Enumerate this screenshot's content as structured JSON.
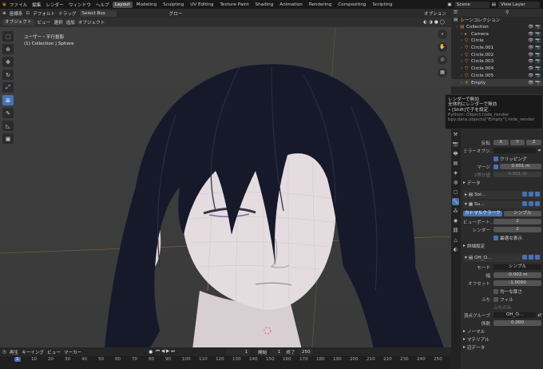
{
  "topbar": {
    "menus": [
      "ファイル",
      "編集",
      "レンダー",
      "ウィンドウ",
      "ヘルプ"
    ],
    "workspaces": [
      "Layout",
      "Modeling",
      "Sculpting",
      "UV Editing",
      "Texture Paint",
      "Shading",
      "Animation",
      "Rendering",
      "Compositing",
      "Scripting"
    ],
    "scene": "Scene",
    "view_layer": "View Layer"
  },
  "viewport": {
    "header1": {
      "mode_items": [
        "座標系",
        "デフォルト",
        "ドラッグ"
      ],
      "select_box": "Select Box",
      "global": "グロー",
      "options": "オプション"
    },
    "header2": {
      "object_mode": "オブジェクト",
      "menus": [
        "ビュー",
        "選択",
        "追加",
        "オブジェクト"
      ]
    },
    "overlay_title": "ユーザー・平行投影",
    "overlay_sub": "(1) Collection | Sphere"
  },
  "timeline": {
    "menus": [
      "再生",
      "キーイング",
      "ビュー",
      "マーカー"
    ],
    "frame": "1",
    "start_label": "開始",
    "start": "1",
    "end_label": "終了",
    "end": "250",
    "ruler": [
      "1",
      "10",
      "20",
      "30",
      "40",
      "50",
      "60",
      "70",
      "80",
      "90",
      "100",
      "110",
      "120",
      "130",
      "140",
      "150",
      "160",
      "170",
      "180",
      "190",
      "200",
      "210",
      "220",
      "230",
      "240",
      "250"
    ]
  },
  "outliner": {
    "title": "シーンコレクション",
    "items": [
      {
        "name": "Collection",
        "level": 0,
        "icon": "collection"
      },
      {
        "name": "Camera",
        "level": 1,
        "icon": "camera"
      },
      {
        "name": "Circle",
        "level": 1,
        "icon": "mesh"
      },
      {
        "name": "Circle.001",
        "level": 1,
        "icon": "mesh"
      },
      {
        "name": "Circle.002",
        "level": 1,
        "icon": "mesh"
      },
      {
        "name": "Circle.003",
        "level": 1,
        "icon": "mesh"
      },
      {
        "name": "Circle.004",
        "level": 1,
        "icon": "mesh"
      },
      {
        "name": "Circle.005",
        "level": 1,
        "icon": "mesh"
      },
      {
        "name": "Empty",
        "level": 1,
        "icon": "empty"
      }
    ]
  },
  "tooltip": {
    "line1": "レンダーで無効",
    "line2": "全体的にレンダーで無効",
    "line3": "• [Shift]で子を設定.",
    "py1": "Python: Object.hide_render",
    "py2": "bpy.data.objects[\"Empty\"].hide_render"
  },
  "properties": {
    "mirror": {
      "axis_label": "反転",
      "axes": [
        "X",
        "Y",
        "Z"
      ],
      "mirror_obj_label": "ミラーオブジ…",
      "clipping": "クリッピング",
      "merge_label": "マージ",
      "merge_value": "0.001 m",
      "bisect_label": "2等分値",
      "bisect_value": "0.001 m",
      "data": "データ"
    },
    "mod2": {
      "name": "Sol…"
    },
    "mod3": {
      "name": "Su…",
      "tab_catmull": "カトマルクラーク",
      "tab_simple": "シンプル",
      "viewport_label": "ビューポート…",
      "viewport_value": "2",
      "render_label": "レンダー",
      "render_value": "2",
      "optimal": "最適な表示",
      "advanced": "詳細設定"
    },
    "mod4": {
      "name": "OH_O…",
      "mode_label": "モード",
      "mode_value": "シンプル",
      "width_label": "幅",
      "width_value": "-0.002 m",
      "offset_label": "オフセット",
      "offset_value": "-1.0000",
      "even": "均一な厚さ",
      "rim_label": "ふち",
      "fill": "フィル",
      "rim_only": "ふちのみ",
      "vgroup_label": "頂点グループ",
      "vgroup_value": "OH_O…",
      "factor_label": "係数",
      "factor_value": "0.000",
      "normal": "ノーマル",
      "material": "マテリアル",
      "shell_data": "辺データ"
    }
  }
}
